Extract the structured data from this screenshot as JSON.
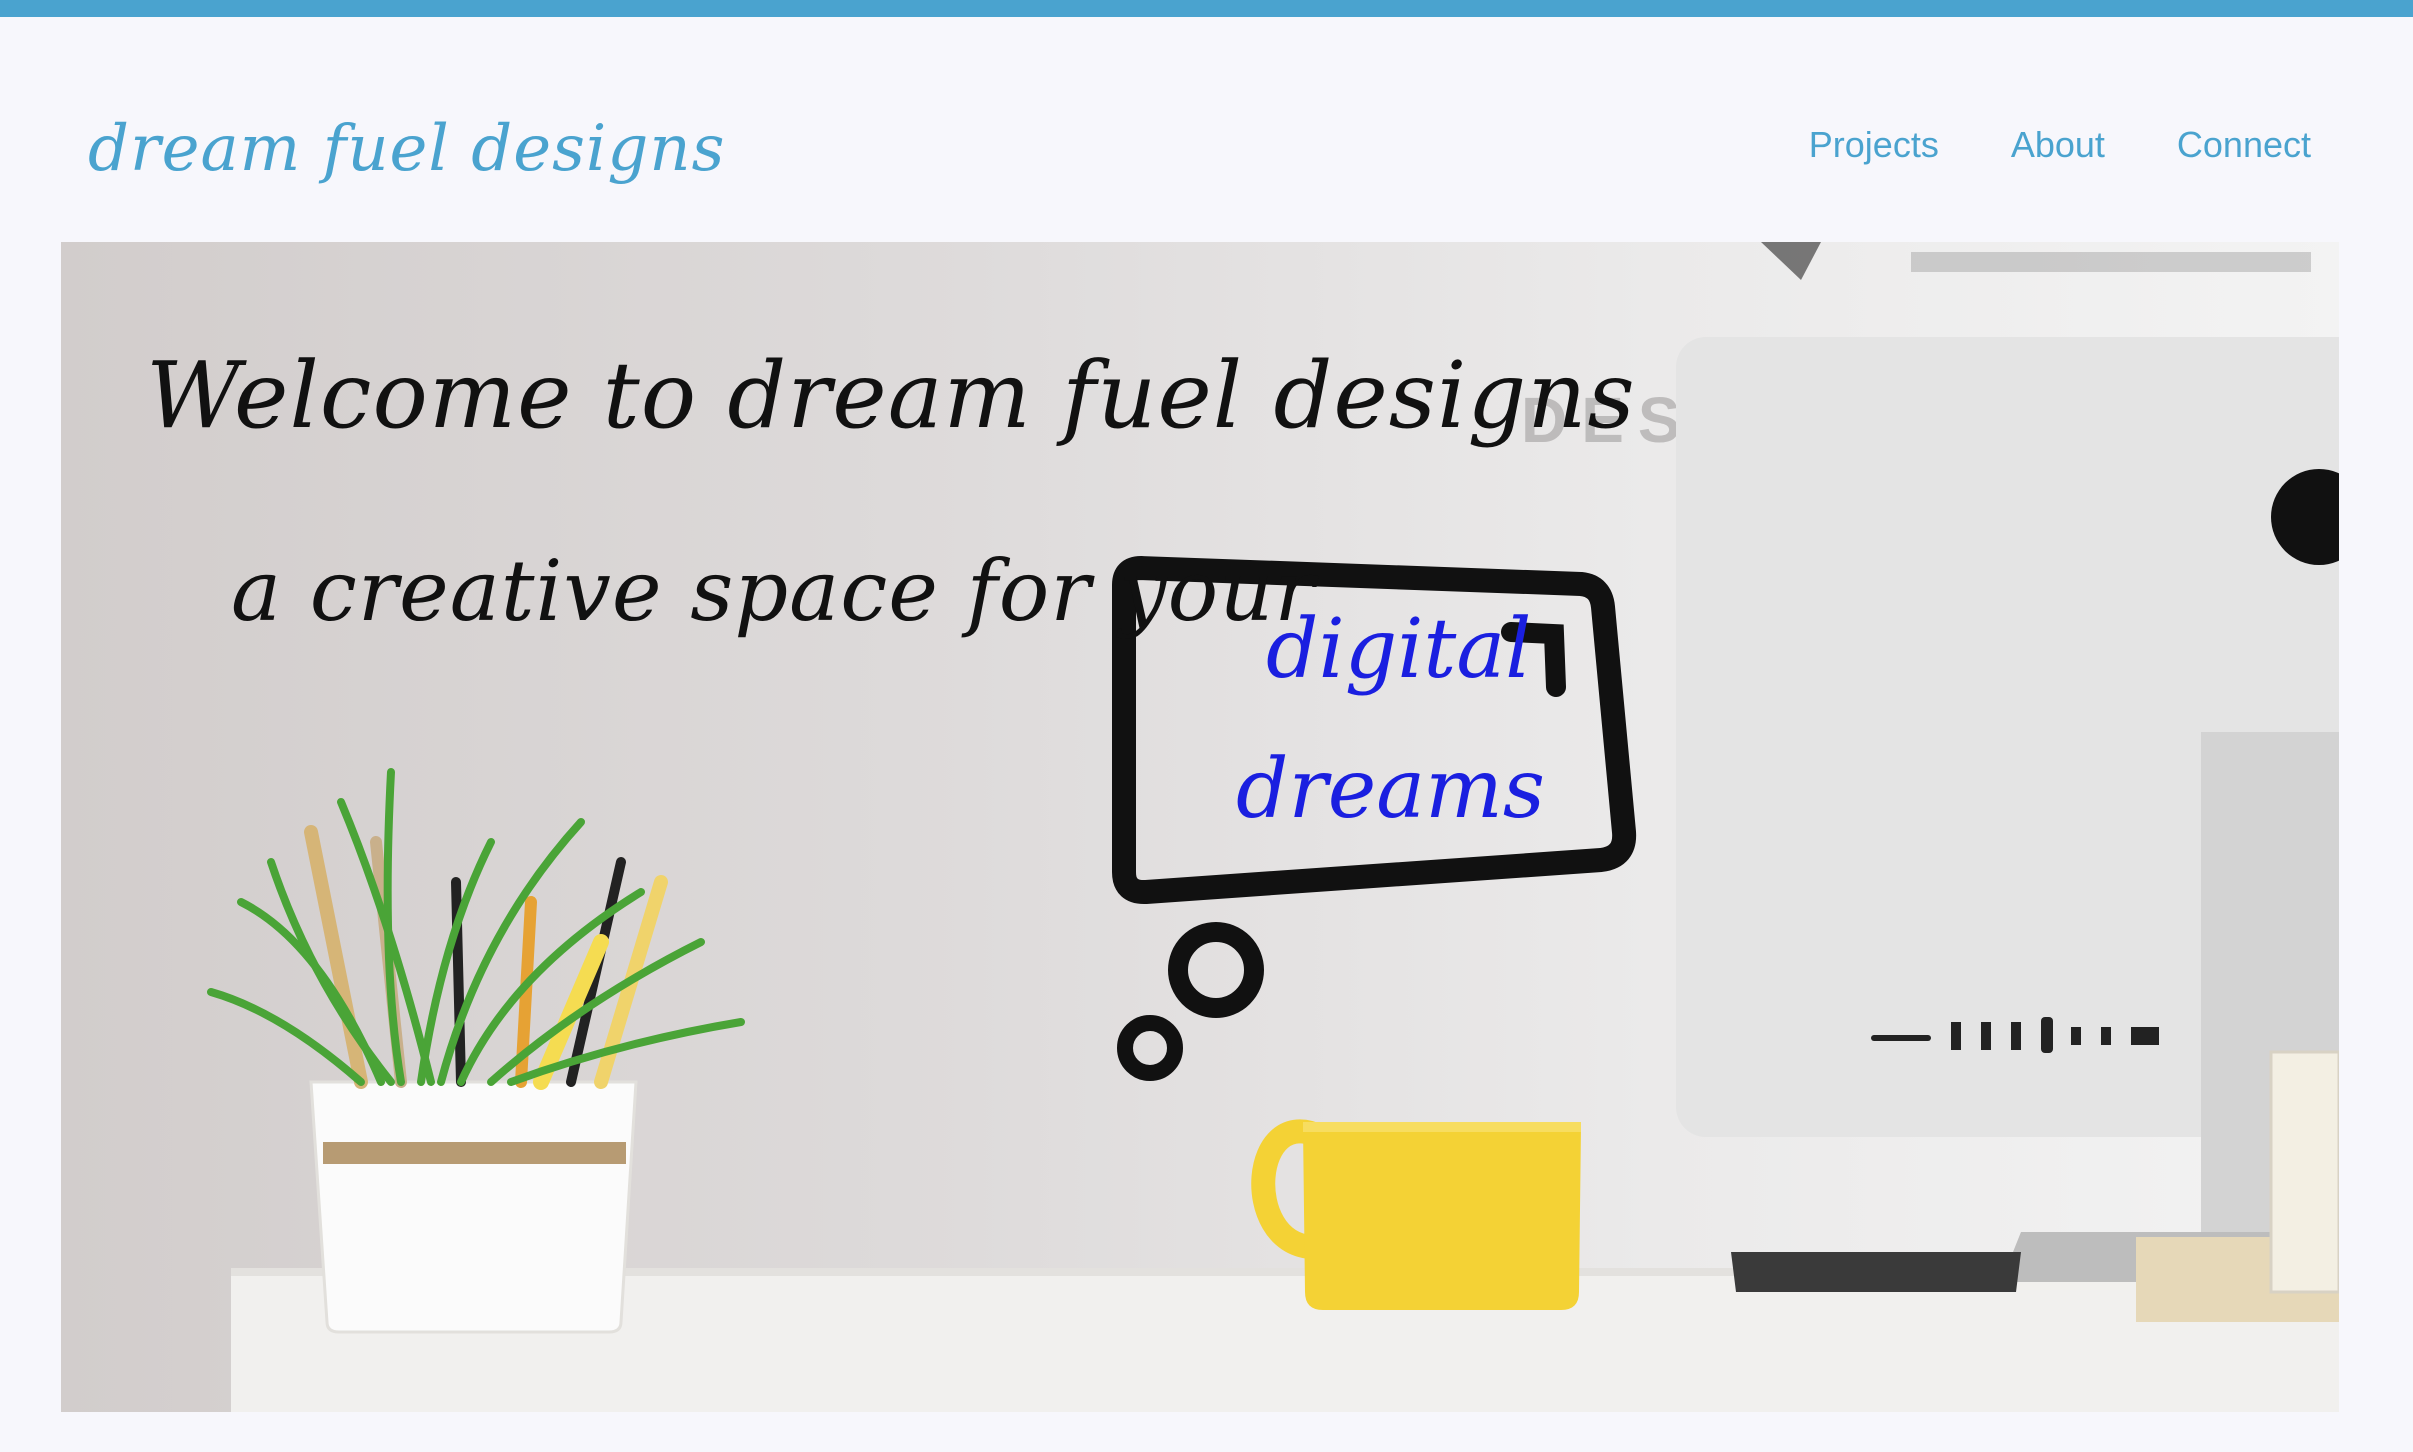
{
  "header": {
    "brand": "dream fuel designs",
    "nav": [
      {
        "label": "Projects"
      },
      {
        "label": "About"
      },
      {
        "label": "Connect"
      }
    ]
  },
  "hero": {
    "title": "Welcome to dream fuel designs",
    "subtitle": "a creative space for your",
    "bubble_line1": "digital",
    "bubble_line2": "dreams",
    "background_letters": "DES"
  },
  "colors": {
    "accent": "#4AA3CF",
    "background": "#F7F7FC",
    "bubble_text": "#1A1FE0",
    "mug": "#F4D235"
  }
}
